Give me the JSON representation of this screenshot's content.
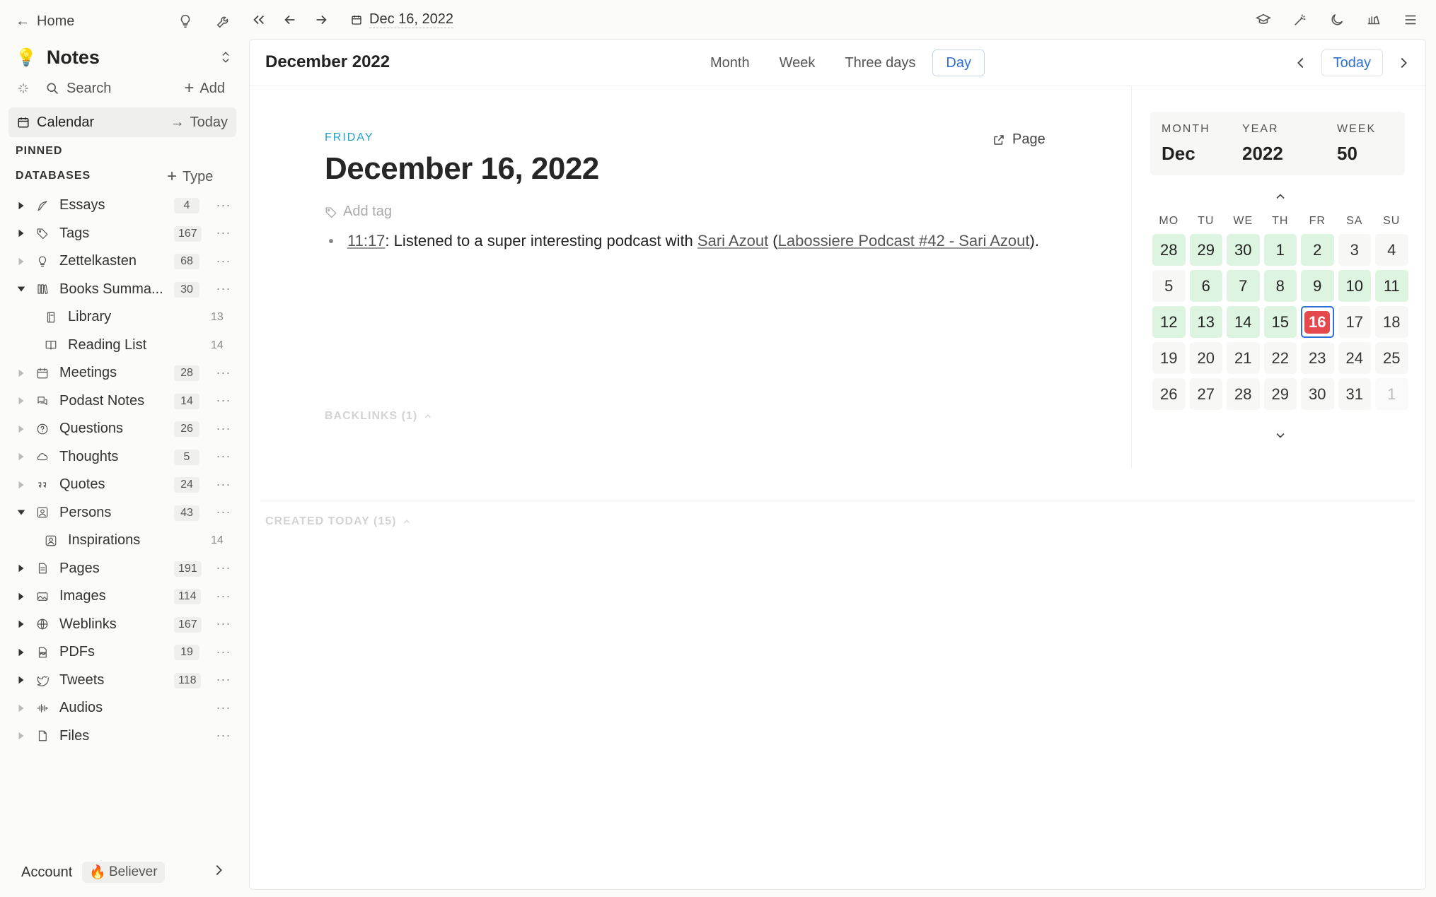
{
  "sidebar": {
    "home_label": "Home",
    "workspace_title": "Notes",
    "search_label": "Search",
    "add_label": "Add",
    "calendar_label": "Calendar",
    "today_link": "Today",
    "pinned_heading": "PINNED",
    "databases_heading": "DATABASES",
    "type_button": "Type",
    "databases": [
      {
        "name": "Essays",
        "count": "4",
        "icon": "quill-icon",
        "expanded": false,
        "child": false
      },
      {
        "name": "Tags",
        "count": "167",
        "icon": "tag-icon",
        "expanded": false,
        "child": false
      },
      {
        "name": "Zettelkasten",
        "count": "68",
        "icon": "bulb-icon",
        "expanded": false,
        "child": false,
        "light_caret": true
      },
      {
        "name": "Books Summa...",
        "count": "30",
        "icon": "books-icon",
        "expanded": true,
        "child": false
      },
      {
        "name": "Library",
        "count": "13",
        "icon": "book-icon",
        "child": true
      },
      {
        "name": "Reading List",
        "count": "14",
        "icon": "open-book-icon",
        "child": true
      },
      {
        "name": "Meetings",
        "count": "28",
        "icon": "calendar-icon",
        "expanded": false,
        "child": false,
        "light_caret": true
      },
      {
        "name": "Podast Notes",
        "count": "14",
        "icon": "chat-icon",
        "expanded": false,
        "child": false,
        "light_caret": true
      },
      {
        "name": "Questions",
        "count": "26",
        "icon": "question-icon",
        "expanded": false,
        "child": false,
        "light_caret": true
      },
      {
        "name": "Thoughts",
        "count": "5",
        "icon": "cloud-icon",
        "expanded": false,
        "child": false,
        "light_caret": true
      },
      {
        "name": "Quotes",
        "count": "24",
        "icon": "quote-icon",
        "expanded": false,
        "child": false,
        "light_caret": true
      },
      {
        "name": "Persons",
        "count": "43",
        "icon": "person-icon",
        "expanded": true,
        "child": false
      },
      {
        "name": "Inspirations",
        "count": "14",
        "icon": "person-icon",
        "child": true
      },
      {
        "name": "Pages",
        "count": "191",
        "icon": "page-icon",
        "expanded": false,
        "child": false
      },
      {
        "name": "Images",
        "count": "114",
        "icon": "image-icon",
        "expanded": false,
        "child": false
      },
      {
        "name": "Weblinks",
        "count": "167",
        "icon": "globe-icon",
        "expanded": false,
        "child": false
      },
      {
        "name": "PDFs",
        "count": "19",
        "icon": "pdf-icon",
        "expanded": false,
        "child": false
      },
      {
        "name": "Tweets",
        "count": "118",
        "icon": "bird-icon",
        "expanded": false,
        "child": false
      },
      {
        "name": "Audios",
        "count": "",
        "icon": "waveform-icon",
        "expanded": false,
        "child": false,
        "light_caret": true
      },
      {
        "name": "Files",
        "count": "",
        "icon": "file-icon",
        "expanded": false,
        "child": false,
        "light_caret": true
      }
    ],
    "more_label": "···",
    "account_label": "Account",
    "plan_badge": "Believer"
  },
  "topbar": {
    "date_crumb": "Dec 16, 2022"
  },
  "header": {
    "month_title": "December 2022",
    "tabs": [
      {
        "label": "Month",
        "active": false
      },
      {
        "label": "Week",
        "active": false
      },
      {
        "label": "Three days",
        "active": false
      },
      {
        "label": "Day",
        "active": true
      }
    ],
    "today_button": "Today"
  },
  "day": {
    "weekday": "FRIDAY",
    "title": "December 16, 2022",
    "page_button": "Page",
    "add_tag": "Add tag",
    "entry": {
      "time": "11:17",
      "text_before": ": Listened to a super interesting podcast with ",
      "person": "Sari Azout",
      "text_mid": " (",
      "link": "Labossiere Podcast #42 - Sari Azout",
      "text_after": ")."
    },
    "backlinks": "BACKLINKS (1)"
  },
  "mini_calendar": {
    "month_label": "MONTH",
    "month_value": "Dec",
    "year_label": "YEAR",
    "year_value": "2022",
    "week_label": "WEEK",
    "week_value": "50",
    "weekdays": [
      "MO",
      "TU",
      "WE",
      "TH",
      "FR",
      "SA",
      "SU"
    ],
    "days": [
      {
        "d": "28",
        "s": "green"
      },
      {
        "d": "29",
        "s": "green"
      },
      {
        "d": "30",
        "s": "green"
      },
      {
        "d": "1",
        "s": "green"
      },
      {
        "d": "2",
        "s": "green"
      },
      {
        "d": "3",
        "s": ""
      },
      {
        "d": "4",
        "s": ""
      },
      {
        "d": "5",
        "s": ""
      },
      {
        "d": "6",
        "s": "green"
      },
      {
        "d": "7",
        "s": "green"
      },
      {
        "d": "8",
        "s": "green"
      },
      {
        "d": "9",
        "s": "green"
      },
      {
        "d": "10",
        "s": "green"
      },
      {
        "d": "11",
        "s": "green"
      },
      {
        "d": "12",
        "s": "green"
      },
      {
        "d": "13",
        "s": "green"
      },
      {
        "d": "14",
        "s": "green"
      },
      {
        "d": "15",
        "s": "green"
      },
      {
        "d": "16",
        "s": "selected"
      },
      {
        "d": "17",
        "s": ""
      },
      {
        "d": "18",
        "s": ""
      },
      {
        "d": "19",
        "s": ""
      },
      {
        "d": "20",
        "s": ""
      },
      {
        "d": "21",
        "s": ""
      },
      {
        "d": "22",
        "s": ""
      },
      {
        "d": "23",
        "s": ""
      },
      {
        "d": "24",
        "s": ""
      },
      {
        "d": "25",
        "s": ""
      },
      {
        "d": "26",
        "s": ""
      },
      {
        "d": "27",
        "s": ""
      },
      {
        "d": "28",
        "s": ""
      },
      {
        "d": "29",
        "s": ""
      },
      {
        "d": "30",
        "s": ""
      },
      {
        "d": "31",
        "s": ""
      },
      {
        "d": "1",
        "s": "muted"
      }
    ]
  },
  "created_today": "CREATED TODAY (15)",
  "colors": {
    "accent": "#2f6fd6",
    "today_red": "#e5484d",
    "note_green": "#dcf4e0",
    "weekday_cyan": "#1fa2c9"
  }
}
